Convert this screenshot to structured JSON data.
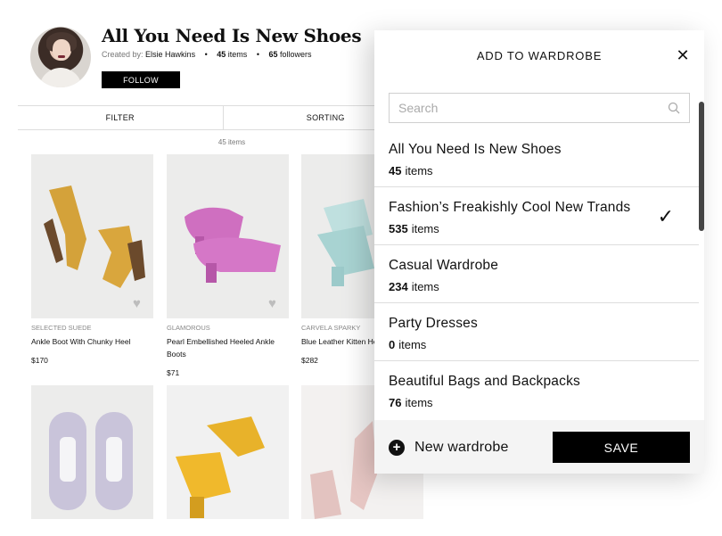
{
  "profile": {
    "title": "All You Need Is New Shoes",
    "created_by_label": "Created by:",
    "creator": "Elsie Hawkins",
    "items_count": "45",
    "items_label": "items",
    "followers_count": "65",
    "followers_label": "followers",
    "follow_label": "FOLLOW"
  },
  "filterbar": {
    "filter_label": "FILTER",
    "sorting_label": "SORTING"
  },
  "results_count": "45 items",
  "products": [
    {
      "brand": "SELECTED SUEDE",
      "name": "Ankle Boot With Chunky Heel",
      "price": "$170"
    },
    {
      "brand": "GLAMOROUS",
      "name": "Pearl Embellished Heeled Ankle Boots",
      "price": "$71"
    },
    {
      "brand": "CARVELA SPARKY",
      "name": "Blue Leather Kitten Heel Boots",
      "price": "$282"
    },
    {
      "brand": "",
      "name": "",
      "price": ""
    },
    {
      "brand": "",
      "name": "",
      "price": ""
    },
    {
      "brand": "",
      "name": "",
      "price": ""
    }
  ],
  "modal": {
    "title": "ADD TO WARDROBE",
    "search_placeholder": "Search",
    "wardrobes": [
      {
        "name": "All You Need Is New Shoes",
        "count": "45",
        "count_label": "items",
        "selected": false
      },
      {
        "name": "Fashion’s Freakishly Cool New Trands",
        "count": "535",
        "count_label": "items",
        "selected": true
      },
      {
        "name": "Casual Wardrobe",
        "count": "234",
        "count_label": "items",
        "selected": false
      },
      {
        "name": "Party Dresses",
        "count": "0",
        "count_label": "items",
        "selected": false
      },
      {
        "name": "Beautiful Bags and Backpacks",
        "count": "76",
        "count_label": "items",
        "selected": false
      }
    ],
    "check_glyph": "✓",
    "close_glyph": "✕",
    "new_wardrobe_label": "New wardrobe",
    "plus_glyph": "+",
    "save_label": "SAVE"
  },
  "icons": {
    "heart": "heart-icon",
    "search": "search-icon",
    "close": "close-icon",
    "check": "checkmark-icon",
    "plus": "plus-circle-icon"
  },
  "colors": {
    "accent": "#000000",
    "footer_bg": "#f4f4f4",
    "divider": "#dddddd"
  }
}
